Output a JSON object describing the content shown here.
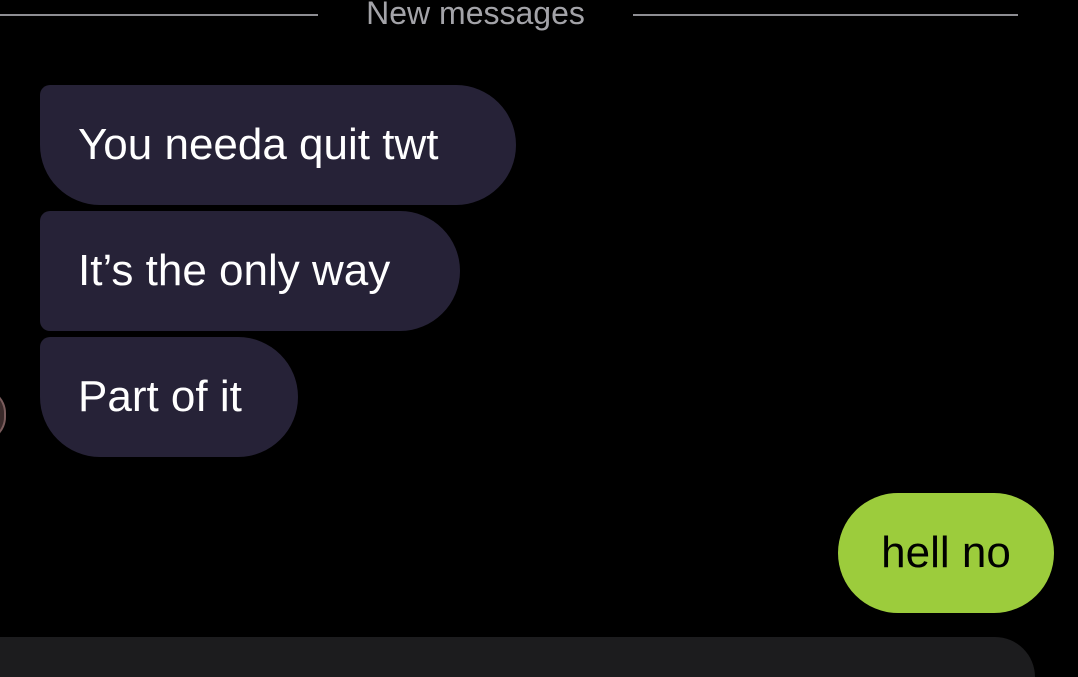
{
  "divider": {
    "label": "New messages"
  },
  "messages": [
    {
      "text": "You needa quit twt",
      "direction": "incoming"
    },
    {
      "text": "It’s the only way",
      "direction": "incoming"
    },
    {
      "text": "Part of it",
      "direction": "incoming"
    },
    {
      "text": "hell no",
      "direction": "outgoing"
    }
  ],
  "colors": {
    "background": "#000000",
    "incoming_bubble": "#262237",
    "outgoing_bubble": "#9ccc3c",
    "divider": "#8e8e93"
  }
}
